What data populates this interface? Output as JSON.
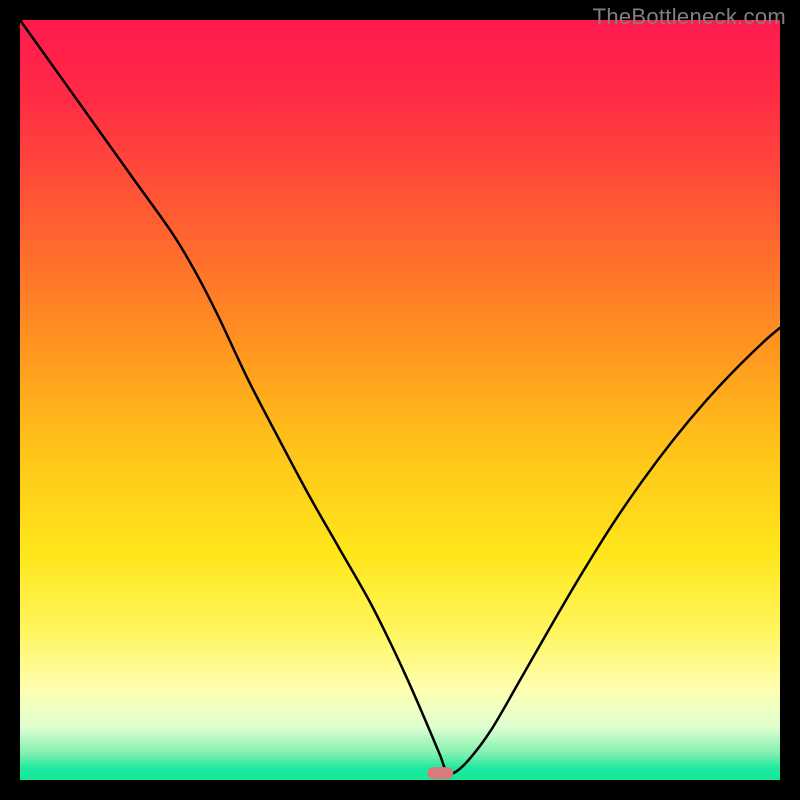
{
  "watermark": "TheBottleneck.com",
  "chart_data": {
    "type": "line",
    "title": "",
    "xlabel": "",
    "ylabel": "",
    "xlim": [
      0,
      100
    ],
    "ylim": [
      0,
      100
    ],
    "background": {
      "type": "vertical-gradient",
      "stops": [
        {
          "offset": 0.0,
          "color": "#ff1a4f"
        },
        {
          "offset": 0.1,
          "color": "#ff2a45"
        },
        {
          "offset": 0.25,
          "color": "#ff5a33"
        },
        {
          "offset": 0.4,
          "color": "#ff8a22"
        },
        {
          "offset": 0.55,
          "color": "#ffbf1a"
        },
        {
          "offset": 0.7,
          "color": "#ffe61a"
        },
        {
          "offset": 0.8,
          "color": "#fff55a"
        },
        {
          "offset": 0.88,
          "color": "#ffffb0"
        },
        {
          "offset": 0.93,
          "color": "#e0ffd0"
        },
        {
          "offset": 0.965,
          "color": "#80f0b0"
        },
        {
          "offset": 0.985,
          "color": "#1de9a0"
        },
        {
          "offset": 1.0,
          "color": "#17e896"
        }
      ]
    },
    "series": [
      {
        "name": "bottleneck-curve",
        "stroke": "#000000",
        "stroke_width": 2.5,
        "x": [
          0,
          5,
          10,
          15,
          20,
          23,
          26,
          30,
          34,
          38,
          42,
          46,
          49,
          51,
          52.5,
          54,
          55.3,
          56,
          57,
          59,
          62,
          66,
          70,
          74,
          78,
          82,
          86,
          90,
          94,
          98,
          100
        ],
        "y": [
          100,
          93,
          86,
          79,
          72,
          67,
          61.2,
          52.7,
          45,
          37.5,
          30.5,
          23.5,
          17.5,
          13.2,
          9.8,
          6.3,
          3.2,
          1.4,
          0.9,
          2.6,
          6.6,
          13.5,
          20.5,
          27.3,
          33.7,
          39.5,
          44.8,
          49.6,
          53.9,
          57.8,
          59.5
        ]
      }
    ],
    "marker": {
      "name": "optimal-marker",
      "shape": "rounded-rect",
      "cx": 55.3,
      "cy": 0.9,
      "width_pct": 3.4,
      "height_pct": 1.6,
      "color": "#d97b7b"
    }
  }
}
